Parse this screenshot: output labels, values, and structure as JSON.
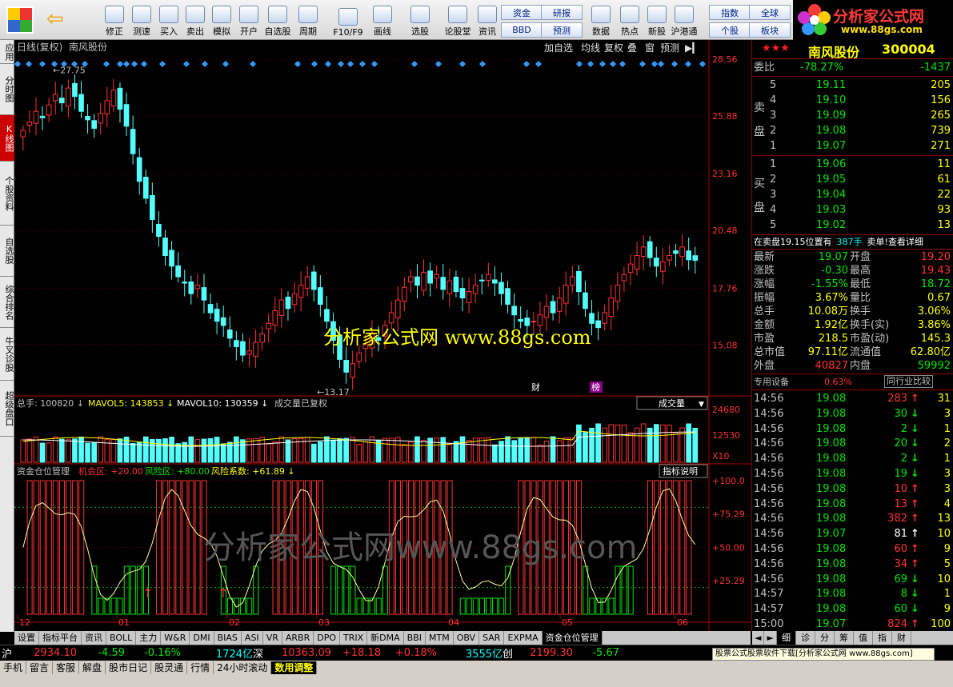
{
  "toolbar": {
    "buttons": [
      {
        "label": "修正",
        "icon": "arrow-updown-icon"
      },
      {
        "label": "测速",
        "icon": "clock-icon"
      },
      {
        "label": "买入",
        "icon": "buy-icon"
      },
      {
        "label": "卖出",
        "icon": "sell-icon"
      },
      {
        "label": "模拟",
        "icon": "hammer-icon"
      },
      {
        "label": "开户",
        "icon": "lock-icon"
      },
      {
        "label": "自选股",
        "icon": "star-list-icon"
      },
      {
        "label": "周期",
        "icon": "cycle-icon"
      },
      {
        "label": "F10/F9",
        "icon": "f10-icon"
      },
      {
        "label": "画线",
        "icon": "pen-icon"
      },
      {
        "label": "选股",
        "icon": "monitor-icon"
      },
      {
        "label": "论股堂",
        "icon": "forum-icon"
      },
      {
        "label": "资讯",
        "icon": "news-icon"
      },
      {
        "label": "数据",
        "icon": "pe-icon"
      },
      {
        "label": "热点",
        "icon": "hot-icon"
      },
      {
        "label": "新股",
        "icon": "doc-icon"
      },
      {
        "label": "沪港通",
        "icon": "hk-icon"
      }
    ],
    "small_buttons": [
      "资金",
      "BBD",
      "研报",
      "预测",
      "指数",
      "个股",
      "全球",
      "板块"
    ]
  },
  "logo": {
    "title": "分析家公式网",
    "url": "www.88gs.com"
  },
  "leftnav": [
    "应用",
    "分时图",
    "K线图",
    "个股资料",
    "自选股",
    "综合排名",
    "牛叉诊股",
    "超级盘口"
  ],
  "chart_header": {
    "period": "日线(复权)",
    "stock": "南风股份",
    "buttons": [
      "加自选",
      "均线",
      "复权",
      "叠",
      "窗",
      "预测"
    ]
  },
  "kline": {
    "price_ticks": [
      "28.56",
      "25.88",
      "23.16",
      "20.48",
      "17.76",
      "15.08"
    ],
    "high_label": "27.75",
    "low_label": "13.17",
    "watermark": "分析家公式网  www.88gs.com",
    "markers": [
      "财",
      "榜"
    ]
  },
  "volume": {
    "label": "总手: 100820",
    "mavol5": "MAVOL5: 143853",
    "mavol10": "MAVOL10: 130359",
    "note": "成交量已复权",
    "selector": "成交量",
    "ticks": [
      "24680",
      "12530",
      "X10"
    ]
  },
  "indicator": {
    "name": "资金仓位管理",
    "opp": "机会区: +20.00",
    "risk": "风险区: +80.00",
    "coef": "风险系数: +61.89",
    "help": "指标说明",
    "ticks": [
      "+100.0",
      "+75.29",
      "+50.00",
      "+25.29"
    ],
    "watermark": "分析家公式网www.88gs.com"
  },
  "x_axis": [
    "12",
    "01",
    "02",
    "03",
    "04",
    "05",
    "06"
  ],
  "chart_data": {
    "type": "candlestick",
    "title": "南风股份",
    "ylim": [
      13.17,
      28.56
    ],
    "closes": [
      25.2,
      25.6,
      26.1,
      25.8,
      26.4,
      26.9,
      26.5,
      27.2,
      26.8,
      26.1,
      25.7,
      25.3,
      26.0,
      26.6,
      27.1,
      26.2,
      25.4,
      24.1,
      22.8,
      22.0,
      21.0,
      20.2,
      19.3,
      18.8,
      18.3,
      18.0,
      17.5,
      17.9,
      17.2,
      16.6,
      16.2,
      16.0,
      15.4,
      15.0,
      14.6,
      14.8,
      15.2,
      15.6,
      16.1,
      16.7,
      17.2,
      16.8,
      17.5,
      17.9,
      18.3,
      17.7,
      17.0,
      16.2,
      15.3,
      14.4,
      13.8,
      14.2,
      14.7,
      15.1,
      15.6,
      15.3,
      16.0,
      16.6,
      17.2,
      17.8,
      18.3,
      17.9,
      18.5,
      18.0,
      18.4,
      17.7,
      18.1,
      17.6,
      17.3,
      17.6,
      17.9,
      18.1,
      18.4,
      18.0,
      17.5,
      17.0,
      16.5,
      16.2,
      16.0,
      16.2,
      16.5,
      16.9,
      16.6,
      17.3,
      17.9,
      18.3,
      17.6,
      16.8,
      16.1,
      15.9,
      16.6,
      17.3,
      17.9,
      18.4,
      18.9,
      19.3,
      19.7,
      19.2,
      18.8,
      19.0,
      19.3,
      19.4,
      19.7,
      19.1,
      19.07
    ],
    "highs_lows_note": "OHLC approximated",
    "volume_label": "总手",
    "indicator": "资金仓位管理"
  },
  "quote": {
    "stock_name": "南风股份",
    "stock_code": "300004",
    "weibi_label": "委比",
    "weibi": "-78.27%",
    "weicha": "-1437",
    "sell_label": "卖盘",
    "buy_label": "买盘",
    "sells": [
      {
        "lvl": "5",
        "price": "19.11",
        "vol": "205"
      },
      {
        "lvl": "4",
        "price": "19.10",
        "vol": "156"
      },
      {
        "lvl": "3",
        "price": "19.09",
        "vol": "265"
      },
      {
        "lvl": "2",
        "price": "19.08",
        "vol": "739"
      },
      {
        "lvl": "1",
        "price": "19.07",
        "vol": "271"
      }
    ],
    "buys": [
      {
        "lvl": "1",
        "price": "19.06",
        "vol": "11"
      },
      {
        "lvl": "2",
        "price": "19.05",
        "vol": "61"
      },
      {
        "lvl": "3",
        "price": "19.04",
        "vol": "22"
      },
      {
        "lvl": "4",
        "price": "19.03",
        "vol": "93"
      },
      {
        "lvl": "5",
        "price": "19.02",
        "vol": "13"
      }
    ],
    "notice": "在卖盘19.15位置有",
    "notice_vol": "387手",
    "notice_end": "卖单!查看详细",
    "stats": [
      [
        "最新",
        "19.07",
        "开盘",
        "19.20"
      ],
      [
        "涨跌",
        "-0.30",
        "最高",
        "19.43"
      ],
      [
        "涨幅",
        "-1.55%",
        "最低",
        "18.72"
      ],
      [
        "振幅",
        "3.67%",
        "量比",
        "0.67"
      ],
      [
        "总手",
        "10.08万",
        "换手",
        "3.06%"
      ],
      [
        "金额",
        "1.92亿",
        "换手(实)",
        "3.86%"
      ],
      [
        "市盈",
        "218.5",
        "市盈(动)",
        "145.3"
      ],
      [
        "总市值",
        "97.11亿",
        "流通值",
        "62.80亿"
      ],
      [
        "外盘",
        "40827",
        "内盘",
        "59992"
      ]
    ],
    "industry": "专用设备",
    "industry_pct": "0.63%",
    "industry_cmp": "同行业比较",
    "ticks": [
      [
        "14:56",
        "19.08",
        "283",
        "31",
        "up"
      ],
      [
        "14:56",
        "19.08",
        "30",
        "3",
        "down"
      ],
      [
        "14:56",
        "19.08",
        "2",
        "1",
        "down"
      ],
      [
        "14:56",
        "19.08",
        "20",
        "2",
        "down"
      ],
      [
        "14:56",
        "19.08",
        "2",
        "1",
        "down"
      ],
      [
        "14:56",
        "19.08",
        "19",
        "3",
        "down"
      ],
      [
        "14:56",
        "19.08",
        "10",
        "3",
        "up"
      ],
      [
        "14:56",
        "19.08",
        "13",
        "4",
        "up"
      ],
      [
        "14:56",
        "19.08",
        "382",
        "13",
        "up"
      ],
      [
        "14:56",
        "19.07",
        "81",
        "10",
        "flat"
      ],
      [
        "14:56",
        "19.08",
        "60",
        "9",
        "up"
      ],
      [
        "14:56",
        "19.08",
        "34",
        "5",
        "up"
      ],
      [
        "14:56",
        "19.08",
        "69",
        "10",
        "down"
      ],
      [
        "14:57",
        "19.08",
        "8",
        "1",
        "down"
      ],
      [
        "14:57",
        "19.08",
        "60",
        "9",
        "down"
      ],
      [
        "15:00",
        "19.07",
        "824",
        "100",
        "up"
      ]
    ],
    "bottom_tabs": [
      "细",
      "诊",
      "分",
      "筹",
      "值",
      "指",
      "财"
    ]
  },
  "bottom_tabs": [
    "设置",
    "指标平台",
    "资讯",
    "BOLL",
    "主力",
    "W&R",
    "DMI",
    "BIAS",
    "ASI",
    "VR",
    "ARBR",
    "DPO",
    "TRIX",
    "新DMA",
    "BBI",
    "MTM",
    "OBV",
    "SAR",
    "EXPMA",
    "资金仓位管理"
  ],
  "statusbar": {
    "sh_label": "沪",
    "sh_val": "2934.10",
    "sh_chg": "-4.59",
    "sh_pct": "-0.16%",
    "sh_amt": "1724亿",
    "sz_label": "深",
    "sz_val": "10363.09",
    "sz_chg": "+18.18",
    "sz_pct": "+0.18%",
    "sz_amt": "3555亿",
    "cy_label": "创",
    "cy_val": "2199.30",
    "cy_chg": "-5.67",
    "ad": "股票公式股票软件下载[分析家公式网 www.88gs.com]"
  },
  "statusbar2": [
    "手机",
    "留言",
    "客服",
    "解盘",
    "股市日记",
    "股灵通",
    "行情",
    "24小时滚动",
    "数用调整"
  ]
}
